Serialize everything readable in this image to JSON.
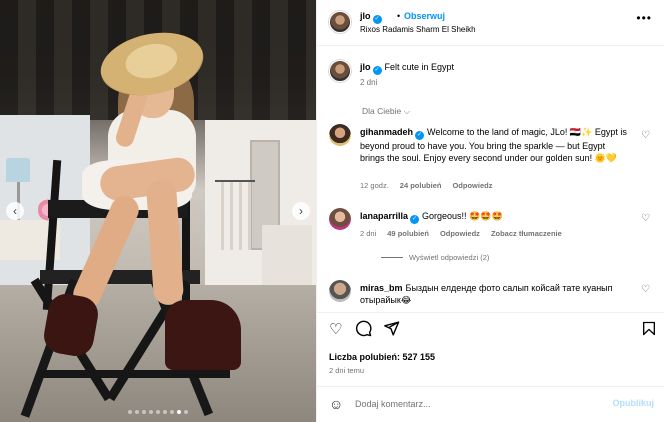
{
  "header": {
    "username": "jlo",
    "follow_label": "Obserwuj",
    "dot": "•",
    "location": "Rixos Radamis Sharm El Sheikh",
    "more_icon": "more-horizontal-icon"
  },
  "caption": {
    "username": "jlo",
    "text": "Felt cute in Egypt",
    "time": "2 dni"
  },
  "for_you_label": "Dla Ciebie",
  "comments": [
    {
      "username": "gihanmadeh",
      "text": "Welcome to the land of magic, JLo! 🇪🇬✨ Egypt is beyond proud to have you. You bring the sparkle — but Egypt brings the soul. Enjoy every second under our golden sun! 🌞💛",
      "time": "12 godz.",
      "likes": "24 polubień",
      "reply": "Odpowiedz"
    },
    {
      "username": "lanaparrilla",
      "text": "Gorgeous!! 🤩🤩🤩",
      "time": "2 dni",
      "likes": "49 polubień",
      "reply": "Odpowiedz",
      "translate": "Zobacz tłumaczenie",
      "view_replies": "Wyświetl odpowiedzi (2)"
    },
    {
      "username": "miras_bm",
      "text": "Быздын елденде фото салып койсай тате куанып отырайык😂"
    }
  ],
  "actions": {
    "like_icon": "heart-icon",
    "comment_icon": "comment-icon",
    "share_icon": "share-icon",
    "save_icon": "bookmark-icon"
  },
  "likes_text": "Liczba polubień: 527 155",
  "post_date": "2 dni temu",
  "composer": {
    "placeholder": "Dodaj komentarz...",
    "publish_label": "Opublikuj"
  },
  "carousel": {
    "slide_count": 9,
    "active_index": 7
  },
  "colors": {
    "accent": "#0095f6",
    "muted": "#737373",
    "publish_disabled": "#b2dffc"
  }
}
